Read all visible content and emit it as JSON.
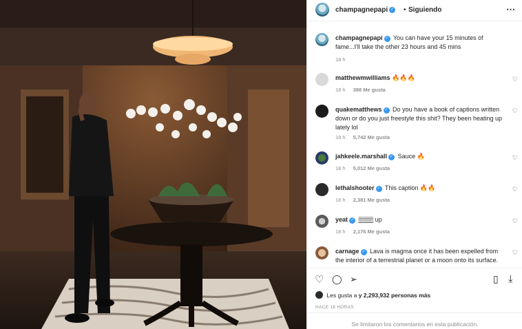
{
  "header": {
    "username": "champagnepapi",
    "separator": "•",
    "follow_status": "Siguiendo",
    "more_icon": "⋯"
  },
  "caption": {
    "username": "champagnepapi",
    "text": "You can have your 15 minutes of fame...I'll take the other 23 hours and 45 mins",
    "time": "18 h"
  },
  "comments": [
    {
      "username": "matthewmwilliams",
      "verified": false,
      "text": "🔥🔥🔥",
      "time": "18 h",
      "likes": "388 Me gusta"
    },
    {
      "username": "quakematthews",
      "verified": true,
      "text": "Do you have a book of captions written down or do you just freestyle this shit? They been heating up lately lol",
      "time": "18 h",
      "likes": "5,742 Me gusta"
    },
    {
      "username": "jahkeele.marshall",
      "verified": true,
      "text": "Sauce 🔥",
      "time": "18 h",
      "likes": "5,012 Me gusta"
    },
    {
      "username": "lethalshooter",
      "verified": true,
      "text": "This caption 🔥🔥",
      "time": "18 h",
      "likes": "2,381 Me gusta"
    },
    {
      "username": "yeat",
      "verified": true,
      "text": "𝄛𝄛𝄛 up",
      "time": "18 h",
      "likes": "2,176 Me gusta"
    },
    {
      "username": "carnage",
      "verified": true,
      "text": "Lava is magma once it has been expelled from the interior of a terrestrial planet or a moon onto its surface.",
      "time": "",
      "likes": ""
    }
  ],
  "actions": {
    "like_icon": "♡",
    "comment_icon": "◯",
    "share_icon": "➢",
    "save_icon": "▯",
    "download_icon": "⤓"
  },
  "likes_line": {
    "prefix": "Les gusta a",
    "user": "",
    "suffix": "y 2,293,932 personas más"
  },
  "posted": "HACE 18 HORAS",
  "comments_limited": "Se limitaron los comentarios en esta publicación."
}
